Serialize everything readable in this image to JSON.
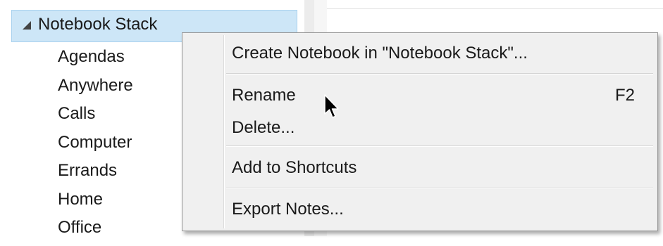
{
  "sidebar": {
    "stack_name": "Notebook Stack",
    "notebooks": [
      "Agendas",
      "Anywhere",
      "Calls",
      "Computer",
      "Errands",
      "Home",
      "Office"
    ]
  },
  "context_menu": {
    "create_notebook": "Create Notebook in \"Notebook Stack\"...",
    "rename": "Rename",
    "rename_shortcut": "F2",
    "delete": "Delete...",
    "add_to_shortcuts": "Add to Shortcuts",
    "export_notes": "Export Notes..."
  },
  "icons": {
    "stack_toggle": "expanded-triangle-icon",
    "cursor": "mouse-pointer-icon"
  },
  "colors": {
    "selection_background": "#cde6f7",
    "selection_border": "#a8d1ee",
    "menu_background": "#f0f0f0",
    "menu_border": "#979797"
  }
}
